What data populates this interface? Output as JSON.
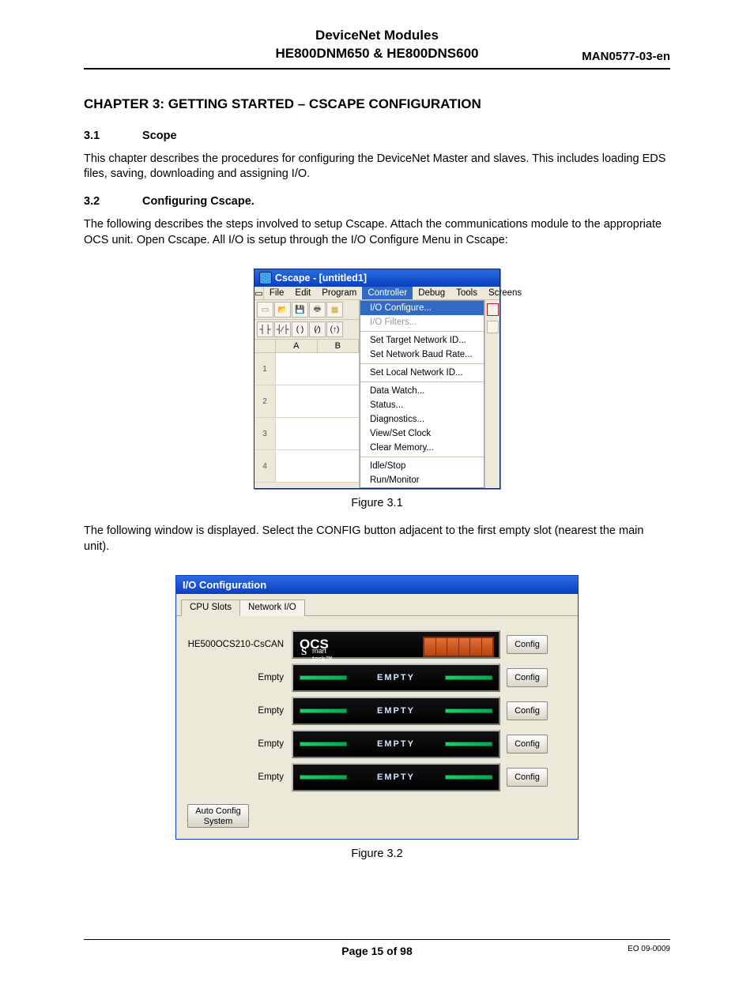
{
  "header": {
    "title_line1": "DeviceNet Modules",
    "title_line2": "HE800DNM650 & HE800DNS600",
    "man": "MAN0577-03-en"
  },
  "chapter_title": "CHAPTER 3: GETTING STARTED – CSCAPE CONFIGURATION",
  "sec31": {
    "num": "3.1",
    "title": "Scope"
  },
  "p31": "This chapter describes the procedures for configuring the DeviceNet Master and slaves.  This includes loading EDS files, saving, downloading and assigning I/O.",
  "sec32": {
    "num": "3.2",
    "title": "Configuring Cscape."
  },
  "p32": "The following describes the steps involved to setup Cscape. Attach the communications module to the appropriate OCS unit. Open Cscape. All I/O is setup through the I/O Configure Menu in Cscape:",
  "cscape": {
    "title": "Cscape - [untitled1]",
    "menus": [
      "File",
      "Edit",
      "Program",
      "Controller",
      "Debug",
      "Tools",
      "Screens"
    ],
    "controller_index": 3,
    "ab": [
      "",
      "A",
      "B"
    ],
    "rows": [
      "1",
      "2",
      "3",
      "4"
    ],
    "dropdown": [
      {
        "label": "I/O Configure...",
        "type": "hl"
      },
      {
        "label": "I/O Filters...",
        "type": "dis"
      },
      {
        "type": "sep"
      },
      {
        "label": "Set Target Network ID...",
        "type": ""
      },
      {
        "label": "Set Network Baud Rate...",
        "type": ""
      },
      {
        "type": "sep"
      },
      {
        "label": "Set Local Network ID...",
        "type": ""
      },
      {
        "type": "sep"
      },
      {
        "label": "Data Watch...",
        "type": ""
      },
      {
        "label": "Status...",
        "type": ""
      },
      {
        "label": "Diagnostics...",
        "type": ""
      },
      {
        "label": "View/Set Clock",
        "type": ""
      },
      {
        "label": "Clear Memory...",
        "type": ""
      },
      {
        "type": "sep"
      },
      {
        "label": "Idle/Stop",
        "type": ""
      },
      {
        "label": "Run/Monitor",
        "type": ""
      }
    ]
  },
  "fig31": "Figure 3.1",
  "p_after_fig31": "The following window is displayed. Select the CONFIG button adjacent to the first empty slot (nearest the main unit).",
  "io": {
    "title": "I/O Configuration",
    "tabs": [
      "CPU Slots",
      "Network I/O"
    ],
    "slots": [
      {
        "label": "HE500OCS210-CsCAN",
        "module": "ocs",
        "config": "Config"
      },
      {
        "label": "Empty",
        "module": "empty",
        "config": "Config"
      },
      {
        "label": "Empty",
        "module": "empty",
        "config": "Config"
      },
      {
        "label": "Empty",
        "module": "empty",
        "config": "Config"
      },
      {
        "label": "Empty",
        "module": "empty",
        "config": "Config"
      }
    ],
    "ocs_text": "OCS",
    "ocs_sub": "mart\ntack™",
    "empty_text": "EMPTY",
    "auto": "Auto Config System"
  },
  "fig32": "Figure 3.2",
  "footer": {
    "page": "Page 15 of 98",
    "eo": "EO 09-0009"
  }
}
